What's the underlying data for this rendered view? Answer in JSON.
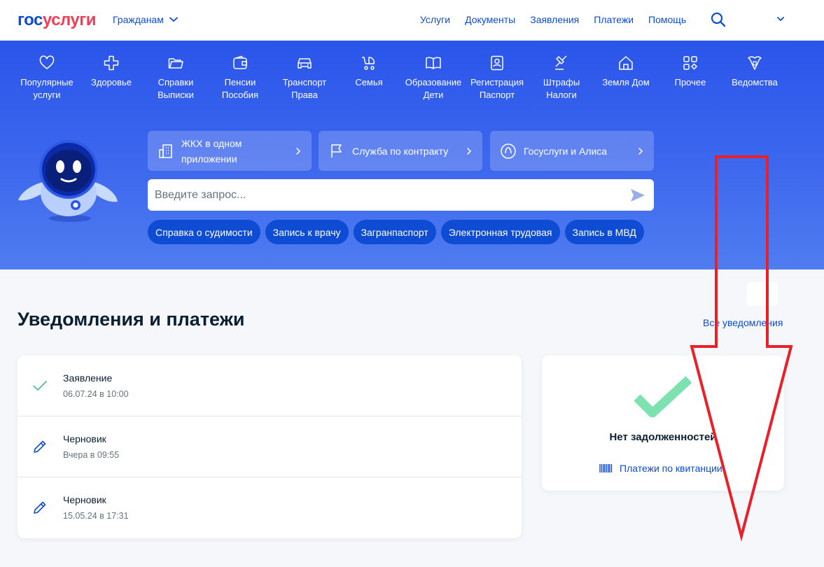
{
  "header": {
    "logo_part1": "гос",
    "logo_part2": "услуги",
    "audience": "Гражданам",
    "nav": [
      "Услуги",
      "Документы",
      "Заявления",
      "Платежи",
      "Помощь"
    ]
  },
  "categories": [
    {
      "label": "Популярные\nуслуги",
      "icon": "heart-icon"
    },
    {
      "label": "Здоровье",
      "icon": "medical-cross-icon"
    },
    {
      "label": "Справки\nВыписки",
      "icon": "folder-icon"
    },
    {
      "label": "Пенсии\nПособия",
      "icon": "wallet-icon"
    },
    {
      "label": "Транспорт\nПрава",
      "icon": "car-icon"
    },
    {
      "label": "Семья",
      "icon": "stroller-icon"
    },
    {
      "label": "Образование\nДети",
      "icon": "book-icon"
    },
    {
      "label": "Регистрация\nПаспорт",
      "icon": "passport-icon"
    },
    {
      "label": "Штрафы\nНалоги",
      "icon": "gavel-icon"
    },
    {
      "label": "Земля Дом",
      "icon": "house-icon"
    },
    {
      "label": "Прочее",
      "icon": "grid-icon"
    },
    {
      "label": "Ведомства",
      "icon": "emblem-icon"
    }
  ],
  "quick_links": [
    {
      "label": "ЖКХ в одном приложении",
      "icon": "building-icon"
    },
    {
      "label": "Служба по контракту",
      "icon": "flag-icon"
    },
    {
      "label": "Госуслуги и Алиса",
      "icon": "alice-icon"
    }
  ],
  "search": {
    "placeholder": "Введите запрос..."
  },
  "chips": [
    "Справка о судимости",
    "Запись к врачу",
    "Загранпаспорт",
    "Электронная трудовая",
    "Запись в МВД"
  ],
  "notifications": {
    "title": "Уведомления и платежи",
    "all_link": "Все уведомления",
    "items": [
      {
        "title": "Заявление",
        "date": "06.07.24 в 10:00",
        "icon": "check-icon"
      },
      {
        "title": "Черновик",
        "date": "Вчера в 09:55",
        "icon": "pencil-icon"
      },
      {
        "title": "Черновик",
        "date": "15.05.24 в 17:31",
        "icon": "pencil-icon"
      }
    ]
  },
  "debts": {
    "title": "Нет задолженностей",
    "link": "Платежи по квитанции"
  },
  "colors": {
    "brand_blue": "#0d4cd3",
    "brand_red": "#ee3f58",
    "success_green": "#7ee2b0"
  },
  "overlay": {
    "arrow_color": "#e8202a"
  }
}
